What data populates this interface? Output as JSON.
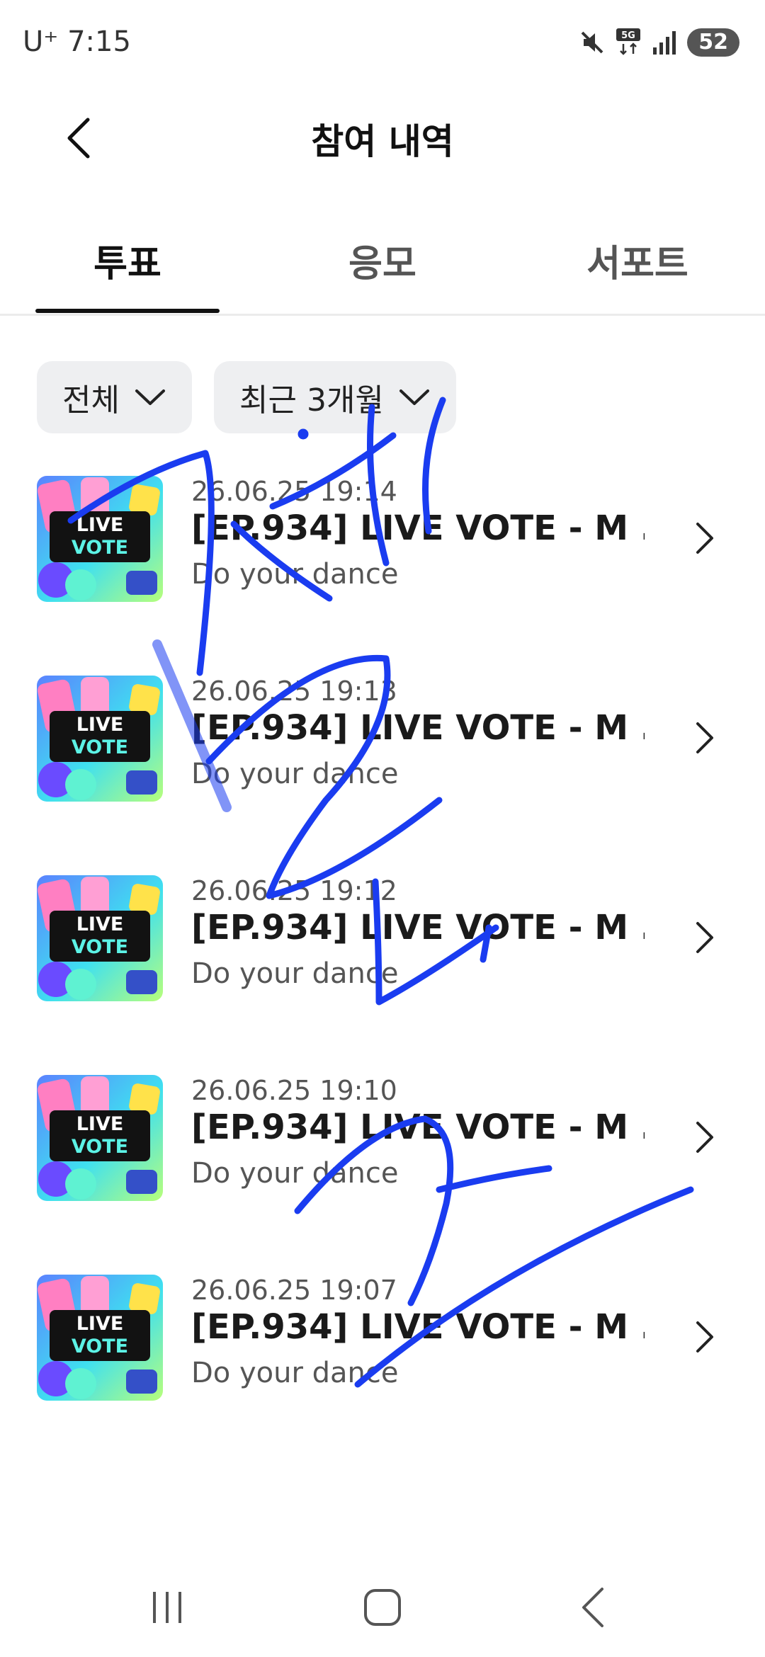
{
  "status_bar": {
    "carrier": "U⁺ 7:15",
    "battery": "52"
  },
  "header": {
    "title": "참여 내역"
  },
  "tabs": [
    {
      "label": "투표",
      "active": true
    },
    {
      "label": "응모",
      "active": false
    },
    {
      "label": "서포트",
      "active": false
    }
  ],
  "filters": {
    "category": "전체",
    "period": "최근 3개월"
  },
  "thumbnail": {
    "line1": "LIVE",
    "line2": "VOTE"
  },
  "items": [
    {
      "date": "26.06.25 19:14",
      "title": "[EP.934] LIVE VOTE - M ...",
      "subtitle": "Do your dance"
    },
    {
      "date": "26.06.25 19:13",
      "title": "[EP.934] LIVE VOTE - M ...",
      "subtitle": "Do your dance"
    },
    {
      "date": "26.06.25 19:12",
      "title": "[EP.934] LIVE VOTE - M ...",
      "subtitle": "Do your dance"
    },
    {
      "date": "26.06.25 19:10",
      "title": "[EP.934] LIVE VOTE - M ...",
      "subtitle": "Do your dance"
    },
    {
      "date": "26.06.25 19:07",
      "title": "[EP.934] LIVE VOTE - M ...",
      "subtitle": "Do your dance"
    }
  ],
  "icons": {
    "status": [
      "mute-icon",
      "5g-data-icon",
      "signal-icon"
    ],
    "header": "back-arrow-icon",
    "nav": [
      "recent-apps-icon",
      "home-icon",
      "back-icon"
    ]
  },
  "colors": {
    "scribble": "#1a3cf0",
    "active_tab": "#111111",
    "filter_bg": "#eeeff1"
  }
}
